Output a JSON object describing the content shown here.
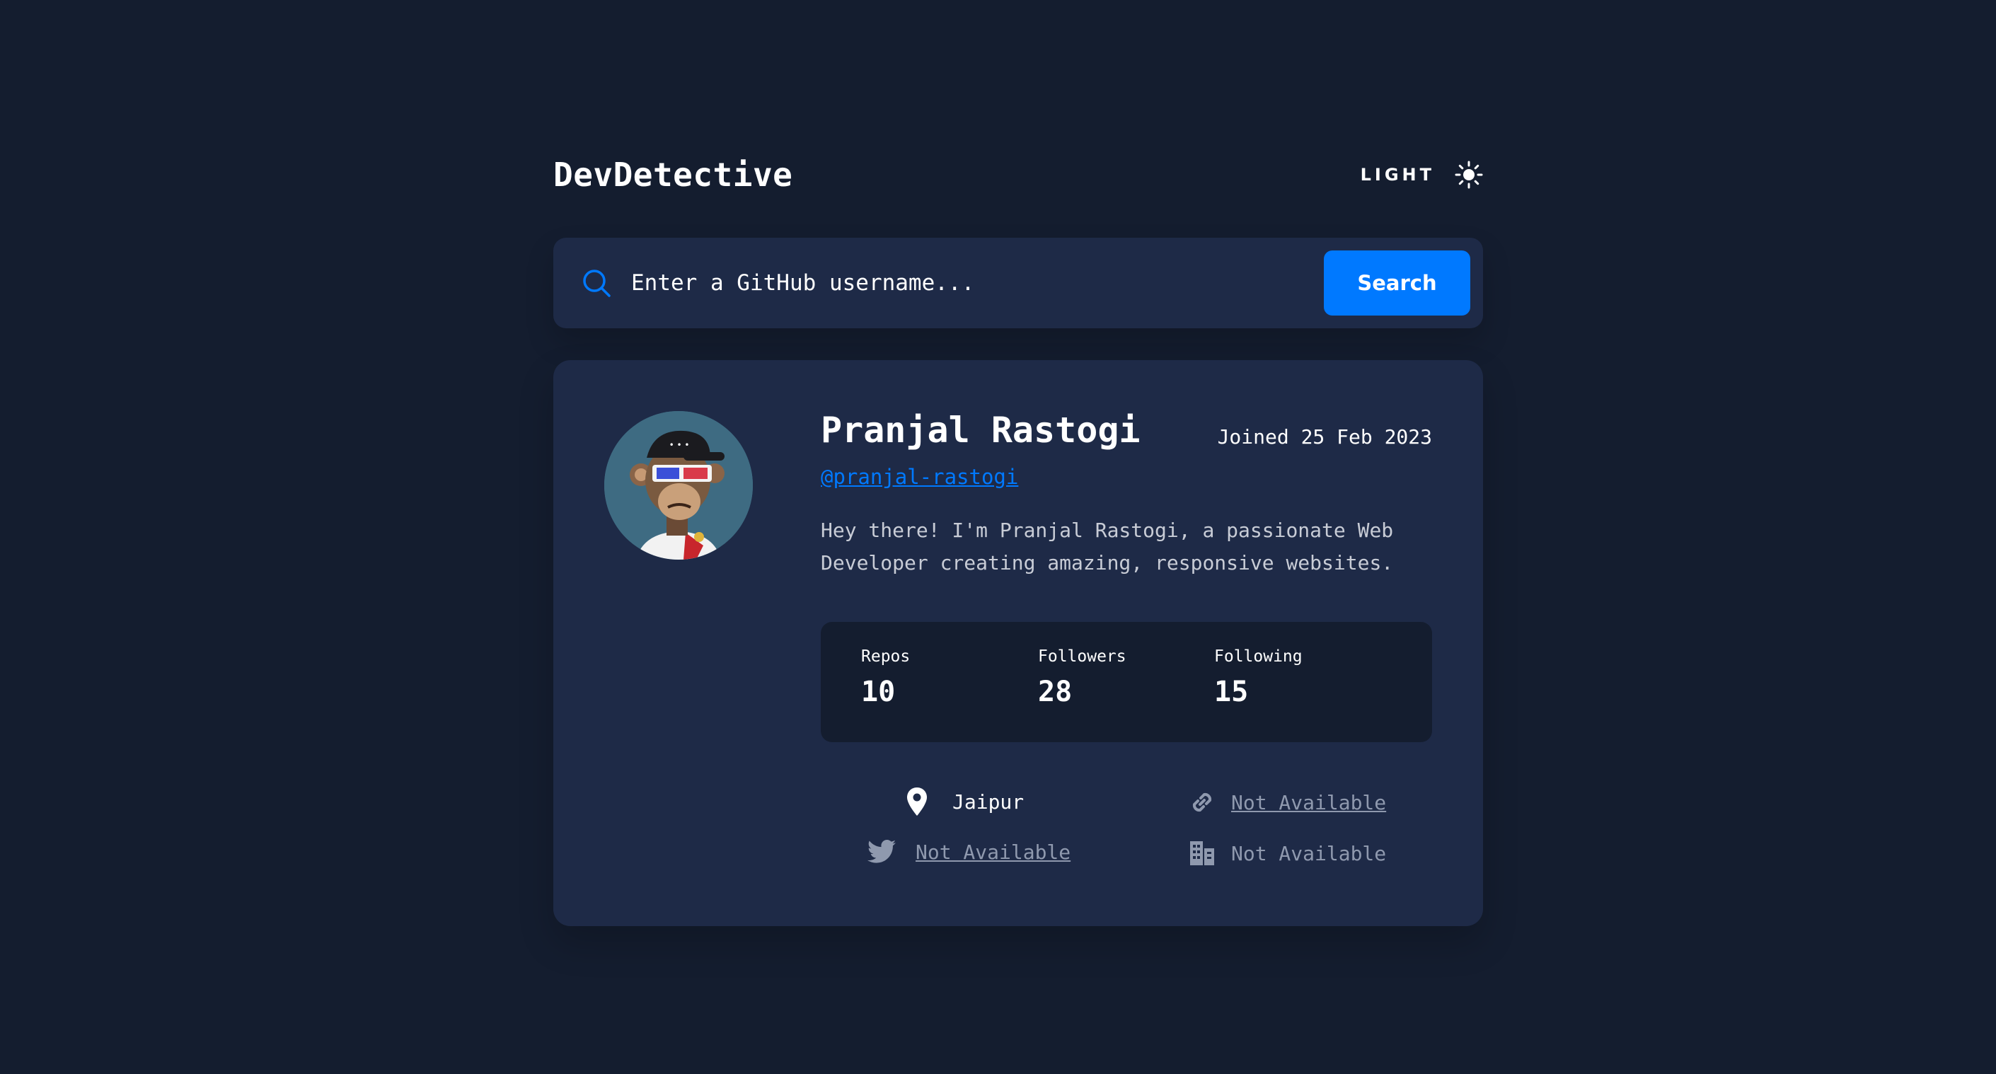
{
  "header": {
    "brand": "DevDetective",
    "theme_toggle_label": "LIGHT",
    "theme_icon": "sun-icon"
  },
  "search": {
    "placeholder": "Enter a GitHub username...",
    "button_label": "Search",
    "icon": "search-icon"
  },
  "profile": {
    "name": "Pranjal Rastogi",
    "joined": "Joined 25 Feb 2023",
    "handle": "@pranjal-rastogi",
    "bio": "Hey there! I'm Pranjal Rastogi, a passionate Web Developer creating amazing, responsive websites.",
    "stats": [
      {
        "label": "Repos",
        "value": "10"
      },
      {
        "label": "Followers",
        "value": "28"
      },
      {
        "label": "Following",
        "value": "15"
      }
    ],
    "links": {
      "location": {
        "icon": "location-pin-icon",
        "text": "Jaipur"
      },
      "website": {
        "icon": "link-icon",
        "text": "Not Available"
      },
      "twitter": {
        "icon": "twitter-icon",
        "text": "Not Available"
      },
      "company": {
        "icon": "building-icon",
        "text": "Not Available"
      }
    }
  },
  "colors": {
    "background": "#141d2f",
    "card": "#1e2a47",
    "accent": "#0079ff",
    "muted": "#8f99ae"
  }
}
